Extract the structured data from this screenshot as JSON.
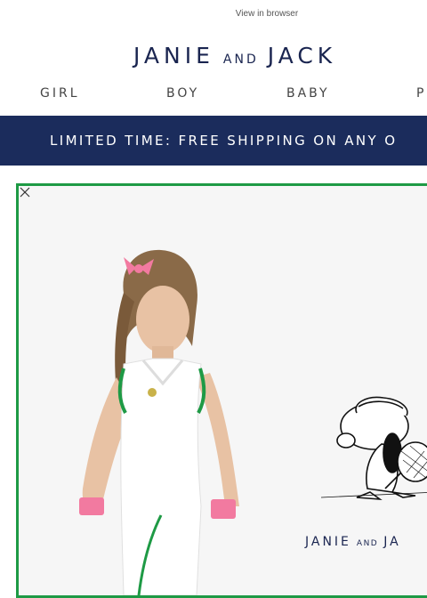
{
  "header": {
    "view_in_browser": "View in browser",
    "logo": {
      "word1": "JANIE",
      "conj": "AND",
      "word2": "JACK"
    }
  },
  "nav": {
    "items": [
      {
        "label": "GIRL"
      },
      {
        "label": "BOY"
      },
      {
        "label": "BABY"
      },
      {
        "label": "P"
      }
    ]
  },
  "promo": {
    "text": "LIMITED TIME: FREE SHIPPING ON ANY O"
  },
  "hero": {
    "border_color": "#1e9a45",
    "brand": {
      "word1": "JANIE",
      "conj": "AND",
      "word2": "JA"
    },
    "close_icon": "close-icon"
  },
  "colors": {
    "navy": "#1a2550",
    "promo_bg": "#1b2c5c",
    "accent_green": "#1e9a45",
    "accent_pink": "#f27aa0"
  }
}
